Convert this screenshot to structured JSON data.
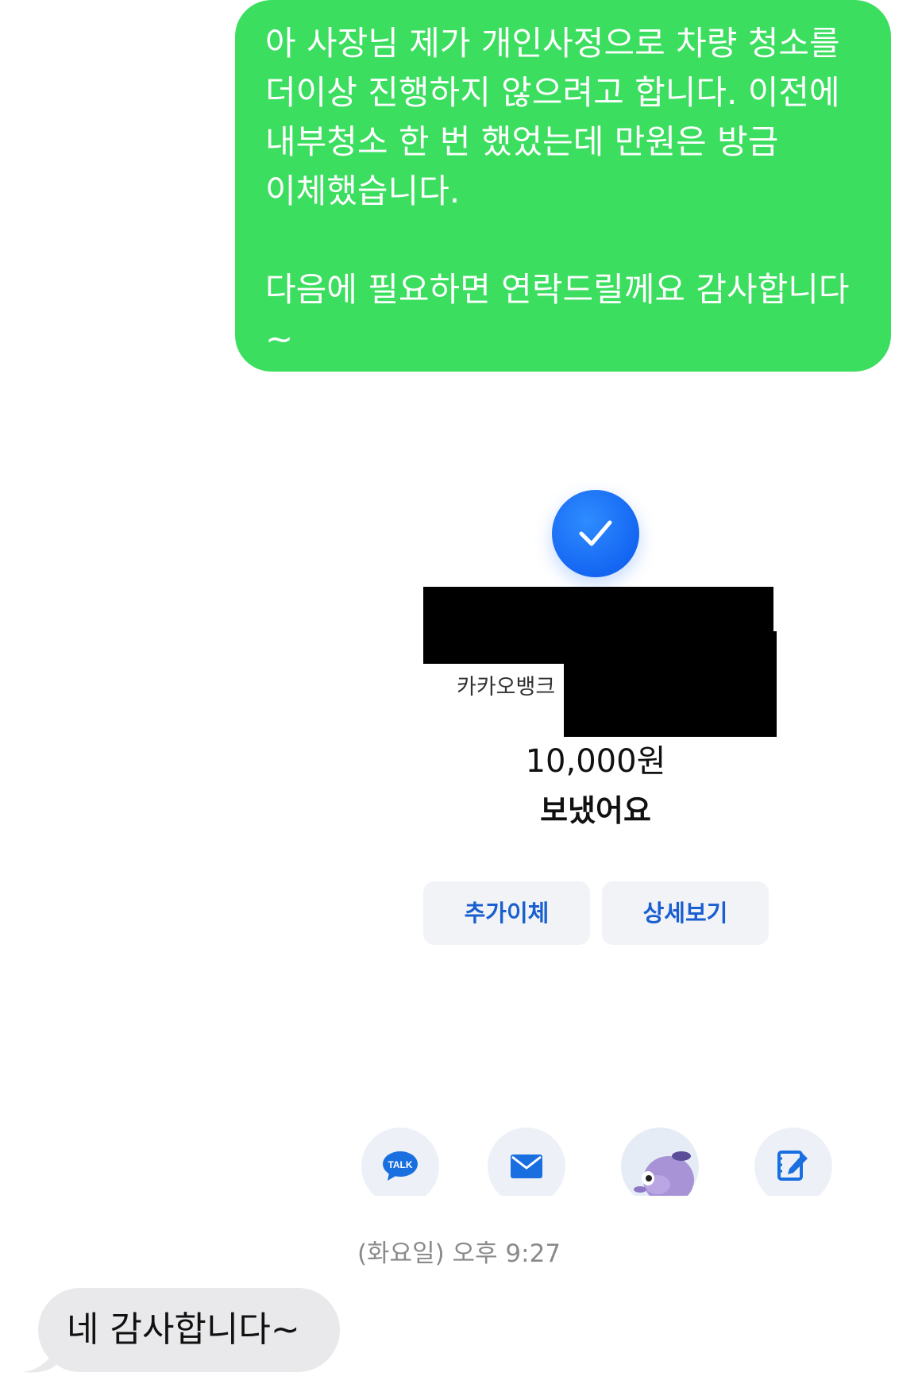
{
  "sent_message": {
    "text": "아 사장님 제가 개인사정으로 차량 청소를 더이상 진행하지 않으려고 합니다. 이전에 내부청소 한 번 했었는데 만원은 방금 이체했습니다.\n\n다음에 필요하면 연락드릴께요 감사합니다~"
  },
  "transfer": {
    "bank_name": "카카오뱅크",
    "amount": "10,000원",
    "status": "보냈어요",
    "buttons": {
      "add_transfer": "추가이체",
      "details": "상세보기"
    },
    "badge_color": "#1466f2"
  },
  "share_icons": [
    "talk-icon",
    "mail-icon",
    "character-avatar-icon",
    "edit-icon"
  ],
  "timestamp": "(화요일) 오후 9:27",
  "received_message": {
    "text": "네 감사합니다~"
  },
  "colors": {
    "sent_bubble": "#3bde5e",
    "received_bubble": "#e9e9eb",
    "button_text": "#1a5fd0"
  }
}
